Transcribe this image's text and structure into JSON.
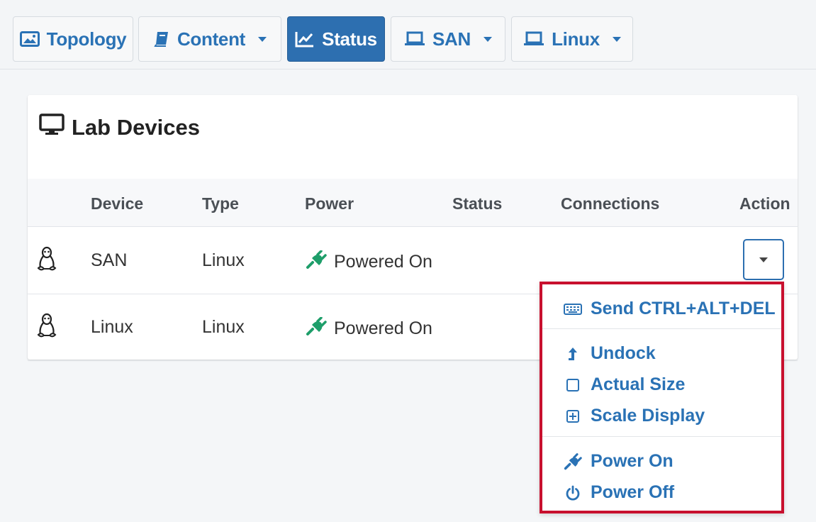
{
  "toolbar": {
    "tabs": [
      {
        "label": "Topology",
        "icon": "image-icon",
        "caret": false,
        "active": false
      },
      {
        "label": "Content",
        "icon": "book-icon",
        "caret": true,
        "active": false
      },
      {
        "label": "Status",
        "icon": "chart-line-icon",
        "caret": false,
        "active": true
      },
      {
        "label": "SAN",
        "icon": "laptop-icon",
        "caret": true,
        "active": false
      },
      {
        "label": "Linux",
        "icon": "laptop-icon",
        "caret": true,
        "active": false
      }
    ]
  },
  "panel": {
    "title": "Lab Devices",
    "title_icon": "desktop-icon",
    "columns": [
      "Device",
      "Type",
      "Power",
      "Status",
      "Connections",
      "Action"
    ],
    "rows": [
      {
        "icon": "linux-penguin-icon",
        "device": "SAN",
        "type": "Linux",
        "power": "Powered On",
        "status": "",
        "connections": ""
      },
      {
        "icon": "linux-penguin-icon",
        "device": "Linux",
        "type": "Linux",
        "power": "Powered On",
        "status": "",
        "connections": ""
      }
    ]
  },
  "action_menu": {
    "items": [
      {
        "label": "Send CTRL+ALT+DEL",
        "icon": "keyboard-icon"
      },
      {
        "label": "Undock",
        "icon": "undock-arrow-icon"
      },
      {
        "label": "Actual Size",
        "icon": "square-icon"
      },
      {
        "label": "Scale Display",
        "icon": "plus-square-icon"
      },
      {
        "label": "Power On",
        "icon": "plug-icon"
      },
      {
        "label": "Power Off",
        "icon": "power-icon"
      }
    ]
  },
  "colors": {
    "accent": "#2d6fb0",
    "link": "#2a72b5",
    "power_green": "#1e9e6a",
    "highlight_border": "#c8102e"
  }
}
